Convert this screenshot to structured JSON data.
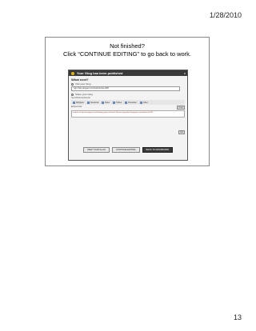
{
  "date": "1/28/2010",
  "page_number": "13",
  "slide": {
    "title_line1": "Not finished?",
    "title_line2": "Click “CONTINUE EDITING” to go back to work."
  },
  "dialog": {
    "header": "Your Glog has been published",
    "close": "x",
    "what_next": "What next?",
    "visit_label": "Visit your Glog",
    "url": "http://help.glogster.com/help/tutorial-1965",
    "share_label": "Share your Glog",
    "share_subtabs": "Send   Bookmark   Email",
    "share_buttons": [
      "MySpace",
      "Facebook",
      "Bebo",
      "Twitter",
      "Friendster",
      "Other"
    ],
    "embed_label": "Embed code",
    "copy_label": "Copy",
    "embed_code": "<embed src='http://www.glogster.com/flash/glog_player.swf?rand=1' flashvars='glog=http://help.glogster.com/help/tutorial-1965' ...",
    "go_label": "Go!",
    "buttons": {
      "view": "VIEW YOUR GLOG",
      "continue": "CONTINUE EDITING",
      "dashboard": "BACK TO DASHBOARD"
    }
  }
}
